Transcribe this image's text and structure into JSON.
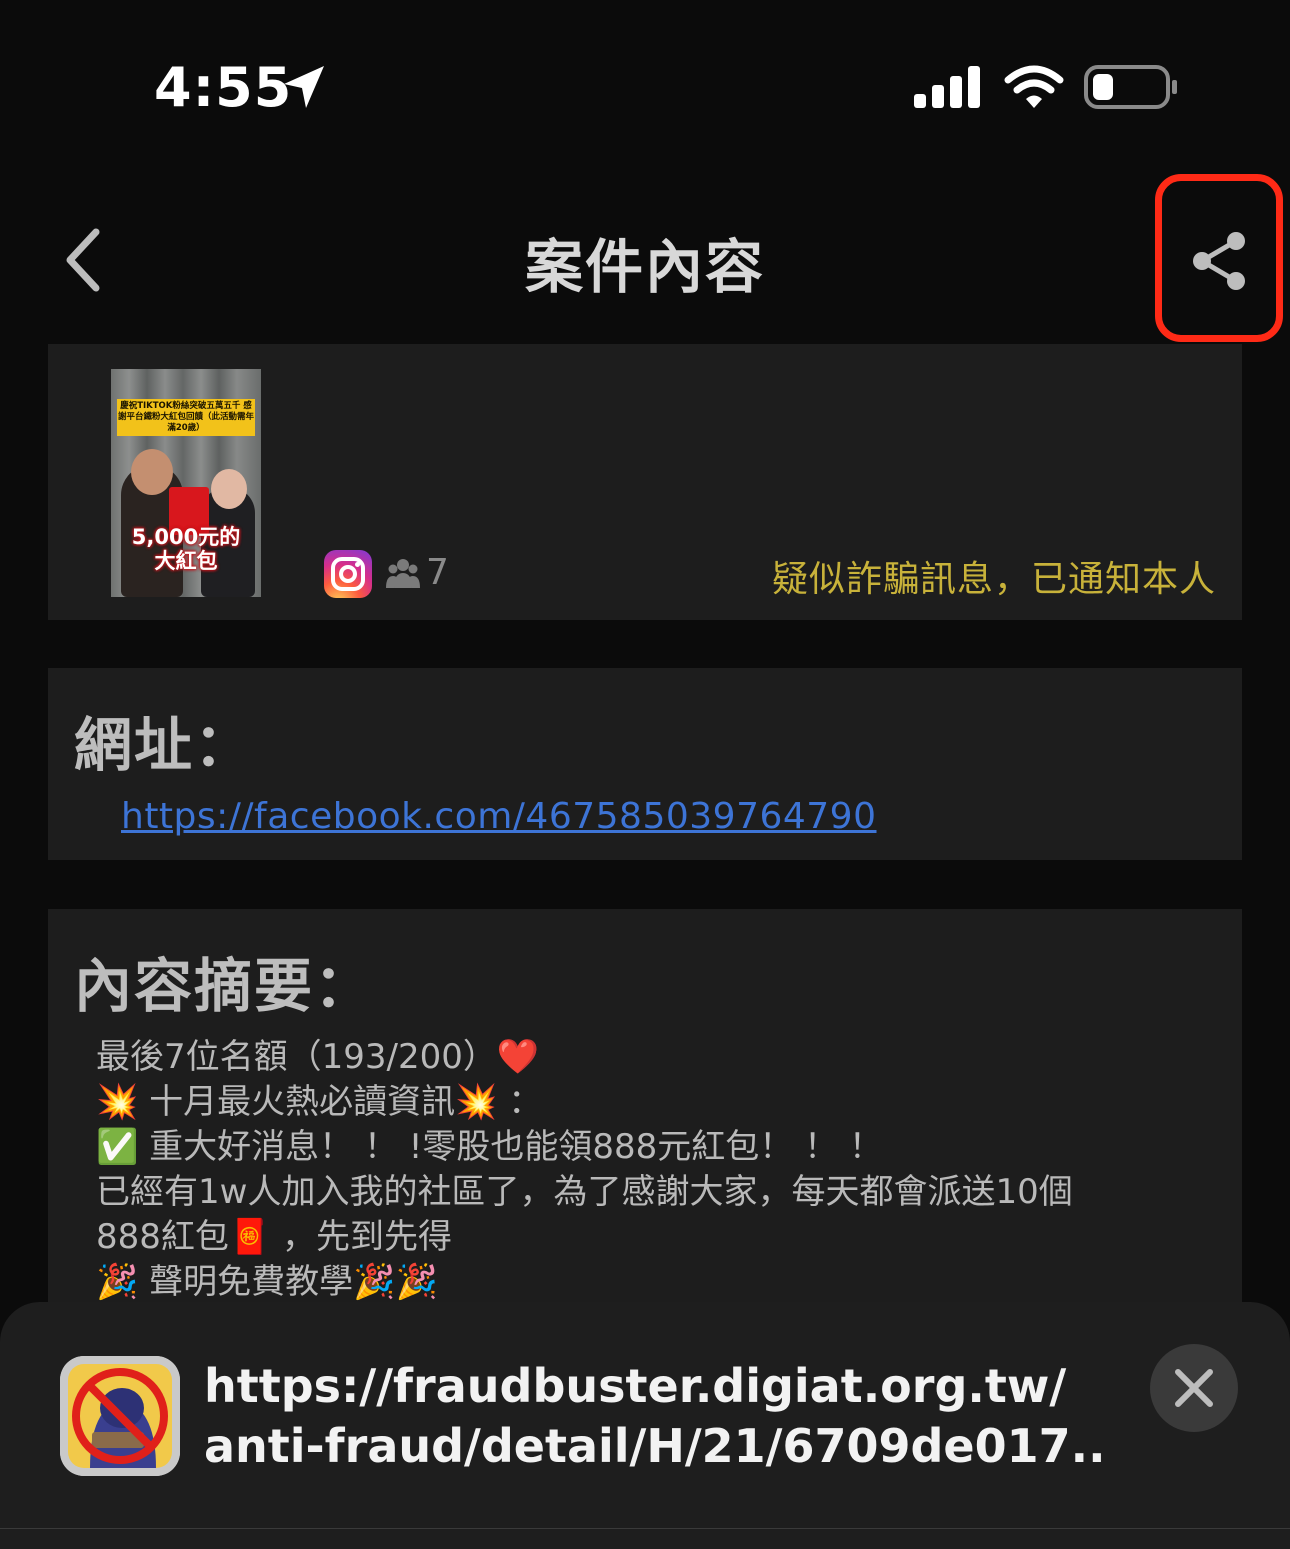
{
  "status_bar": {
    "time": "4:55",
    "icons": [
      "location-arrow-icon",
      "cellular-signal-icon",
      "wifi-icon",
      "battery-icon"
    ]
  },
  "nav": {
    "title": "案件內容",
    "back_icon": "chevron-left-icon",
    "share_icon": "share-icon",
    "highlight_color": "#ff2a16"
  },
  "case": {
    "thumbnail": {
      "banner_text": "慶祝TIKTOK粉絲突破五萬五千 感謝平台鐵粉大紅包回饋（此活動需年滿20歲）",
      "caption": "5,000元的 大紅包"
    },
    "platform_icon": "instagram-icon",
    "people_count": "7",
    "status": "疑似詐騙訊息，已通知本人",
    "status_color": "#c8b23a"
  },
  "url_section": {
    "heading": "網址：",
    "link": "https://facebook.com/467585039764790",
    "link_color": "#3d74d6"
  },
  "summary_section": {
    "heading": "內容摘要：",
    "lines": [
      "最後7位名額（193/200）❤️",
      "💥 十月最火熱必讀資訊💥 ：",
      " ✅ 重大好消息！ ！ !零股也能領888元紅包！ ！ ！",
      " 已經有1w人加入我的社區了，為了感謝大家，每天都會派送10個",
      "888紅包🧧 ，先到先得",
      "  🎉  聲明免費教學🎉🎉"
    ]
  },
  "share_sheet": {
    "url_line1": "https://fraudbuster.digiat.org.tw/",
    "url_line2": "anti-fraud/detail/H/21/6709de017...",
    "close_icon": "close-icon"
  }
}
